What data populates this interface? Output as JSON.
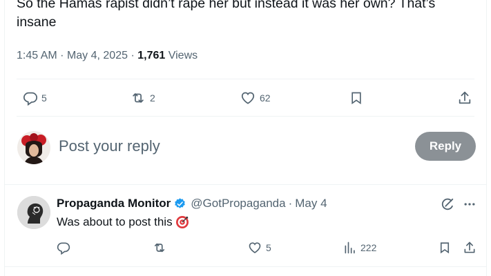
{
  "tweet": {
    "text": "So the Hamas rapist didn’t rape her but instead it was her own? That’s insane",
    "time": "1:45 AM",
    "date": "May 4, 2025",
    "views_count": "1,761",
    "views_label": "Views",
    "replies": "5",
    "reposts": "2",
    "likes": "62"
  },
  "composer": {
    "placeholder": "Post your reply",
    "button_label": "Reply"
  },
  "reply": {
    "name": "Propaganda Monitor",
    "handle": "@GotPropaganda",
    "date": "May 4",
    "text": "Was about to post this",
    "emoji": "🎯",
    "likes": "5",
    "views": "222"
  },
  "colors": {
    "text_primary": "#0f1419",
    "text_secondary": "#536471",
    "verified": "#1d9bf0",
    "reply_button_disabled": "#8b9196",
    "divider": "#eff3f4"
  },
  "icons": [
    "reply-icon",
    "repost-icon",
    "like-icon",
    "bookmark-icon",
    "share-icon",
    "verified-badge-icon",
    "grok-icon",
    "more-icon",
    "views-icon",
    "target-emoji"
  ]
}
